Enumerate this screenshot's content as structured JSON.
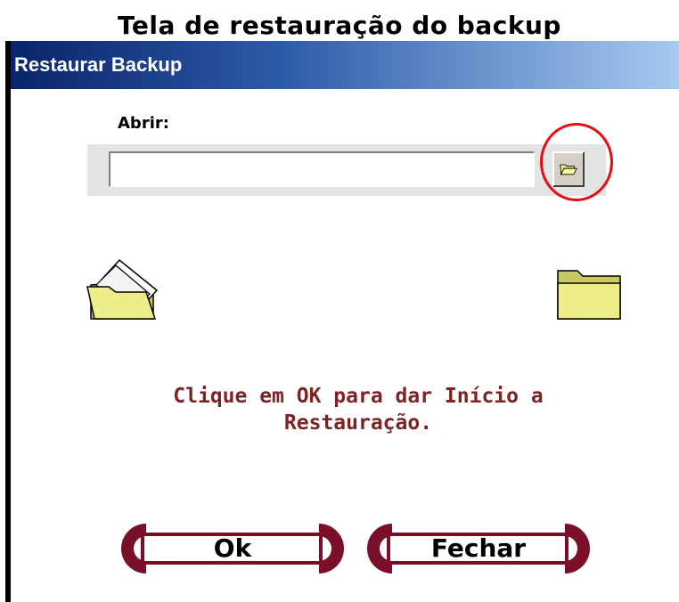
{
  "page_caption": "Tela de restauração do backup",
  "window": {
    "title": "Restaurar Backup"
  },
  "form": {
    "open_label": "Abrir:",
    "path_value": ""
  },
  "message": "Clique em OK para dar Início a\nRestauração.",
  "buttons": {
    "ok_label": "Ok",
    "close_label": "Fechar"
  },
  "icons": {
    "browse": "folder-open-icon",
    "left": "open-folder-icon",
    "right": "closed-folder-icon"
  },
  "colors": {
    "accent": "#7a0f2a",
    "message": "#7a2424",
    "highlight": "#e01010"
  }
}
